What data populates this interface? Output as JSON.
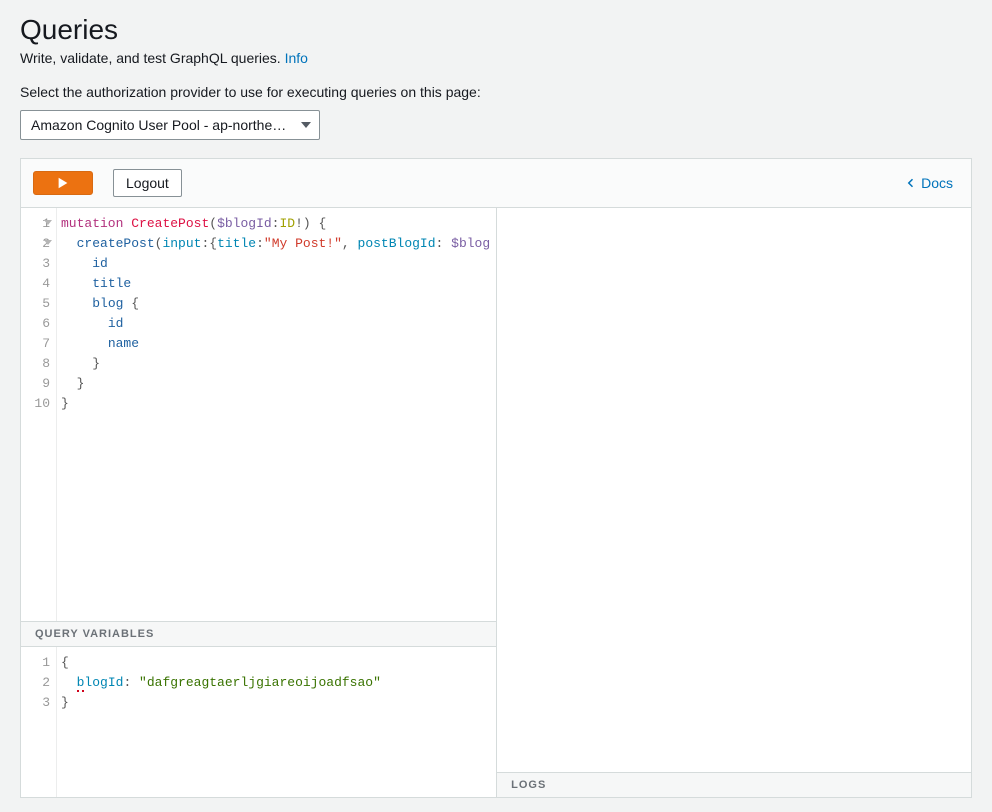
{
  "header": {
    "title": "Queries",
    "subtitle_prefix": "Write, validate, and test GraphQL queries. ",
    "info_link": "Info",
    "auth_label": "Select the authorization provider to use for executing queries on this page:",
    "auth_selected": "Amazon Cognito User Pool - ap-northe…"
  },
  "toolbar": {
    "run_label": "Run",
    "logout_label": "Logout",
    "docs_label": "Docs"
  },
  "editor": {
    "lines": [
      {
        "n": 1,
        "fold": true,
        "tokens": [
          {
            "t": "mutation",
            "c": "kw"
          },
          {
            "t": " "
          },
          {
            "t": "CreatePost",
            "c": "name"
          },
          {
            "t": "(",
            "c": "punc"
          },
          {
            "t": "$blogId",
            "c": "arg"
          },
          {
            "t": ":",
            "c": "punc"
          },
          {
            "t": "ID",
            "c": "type"
          },
          {
            "t": "!",
            "c": "punc"
          },
          {
            "t": ") {",
            "c": "punc"
          }
        ]
      },
      {
        "n": 2,
        "fold": true,
        "tokens": [
          {
            "t": "  "
          },
          {
            "t": "createPost",
            "c": "field"
          },
          {
            "t": "(",
            "c": "punc"
          },
          {
            "t": "input",
            "c": "id"
          },
          {
            "t": ":{",
            "c": "punc"
          },
          {
            "t": "title",
            "c": "id"
          },
          {
            "t": ":",
            "c": "punc"
          },
          {
            "t": "\"My Post!\"",
            "c": "str"
          },
          {
            "t": ", ",
            "c": "punc"
          },
          {
            "t": "postBlogId",
            "c": "id"
          },
          {
            "t": ": ",
            "c": "punc"
          },
          {
            "t": "$blog",
            "c": "arg"
          }
        ]
      },
      {
        "n": 3,
        "tokens": [
          {
            "t": "    "
          },
          {
            "t": "id",
            "c": "field"
          }
        ]
      },
      {
        "n": 4,
        "tokens": [
          {
            "t": "    "
          },
          {
            "t": "title",
            "c": "field"
          }
        ]
      },
      {
        "n": 5,
        "tokens": [
          {
            "t": "    "
          },
          {
            "t": "blog",
            "c": "field"
          },
          {
            "t": " {",
            "c": "punc"
          }
        ]
      },
      {
        "n": 6,
        "tokens": [
          {
            "t": "      "
          },
          {
            "t": "id",
            "c": "field"
          }
        ]
      },
      {
        "n": 7,
        "tokens": [
          {
            "t": "      "
          },
          {
            "t": "name",
            "c": "field"
          }
        ]
      },
      {
        "n": 8,
        "tokens": [
          {
            "t": "    }",
            "c": "punc"
          }
        ]
      },
      {
        "n": 9,
        "tokens": [
          {
            "t": "  }",
            "c": "punc"
          }
        ]
      },
      {
        "n": 10,
        "tokens": [
          {
            "t": "}",
            "c": "punc"
          }
        ]
      }
    ]
  },
  "vars_label": "QUERY VARIABLES",
  "vars": {
    "lines": [
      {
        "n": 1,
        "tokens": [
          {
            "t": "{",
            "c": "punc"
          }
        ]
      },
      {
        "n": 2,
        "tokens": [
          {
            "t": "  "
          },
          {
            "t": "b",
            "c": "id err",
            "u": true
          },
          {
            "t": "logId",
            "c": "id"
          },
          {
            "t": ": ",
            "c": "punc"
          },
          {
            "t": "\"dafgreagtaerljgiareoijoadfsao\"",
            "c": "var"
          }
        ]
      },
      {
        "n": 3,
        "tokens": [
          {
            "t": "}",
            "c": "punc"
          }
        ]
      }
    ]
  },
  "logs_label": "LOGS"
}
